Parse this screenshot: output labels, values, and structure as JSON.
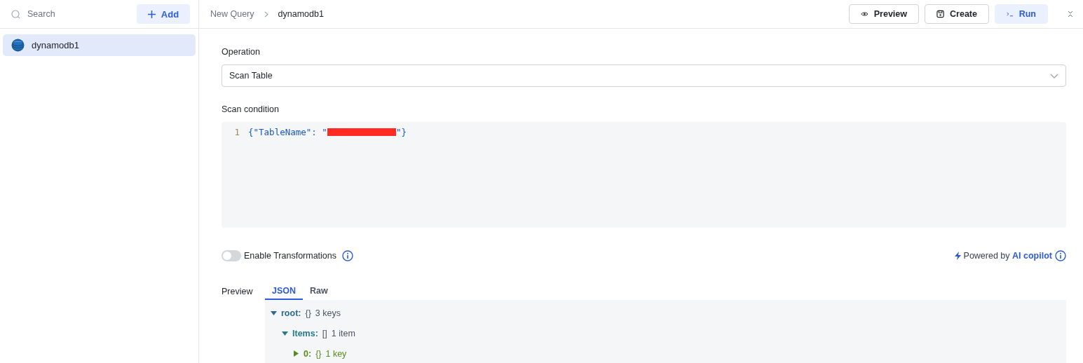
{
  "sidebar": {
    "search": {
      "placeholder": "Search"
    },
    "add_button": "Add",
    "items": [
      {
        "label": "dynamodb1",
        "selected": true
      }
    ]
  },
  "breadcrumb": [
    "New Query",
    "dynamodb1"
  ],
  "toolbar": {
    "buttons": [
      {
        "kind": "preview",
        "label": "Preview"
      },
      {
        "kind": "create",
        "label": "Create"
      },
      {
        "kind": "run",
        "label": "Run"
      }
    ]
  },
  "operation": {
    "label": "Operation",
    "value": "Scan Table"
  },
  "scan_condition": {
    "label": "Scan condition",
    "lines": [
      {
        "number": "1",
        "before": "{\"TableName\": \"",
        "after": "\"}",
        "redacted": true
      }
    ]
  },
  "transformations": {
    "label": "Enable Transformations",
    "on": false
  },
  "copilot": {
    "prefix": "Powered by",
    "name": "AI copilot"
  },
  "preview": {
    "label": "Preview",
    "tabs": [
      {
        "label": "JSON",
        "selected": true
      },
      {
        "label": "Raw",
        "selected": false
      }
    ],
    "tree": [
      {
        "key": "root:",
        "brackets": "{}",
        "summary": "3 keys",
        "expanded": true,
        "children": [
          {
            "key": "Items:",
            "brackets": "[]",
            "summary": "1 item",
            "expanded": true,
            "children": [
              {
                "key": "0:",
                "brackets": "{}",
                "summary": "1 key",
                "expanded": false
              }
            ]
          }
        ]
      }
    ]
  }
}
